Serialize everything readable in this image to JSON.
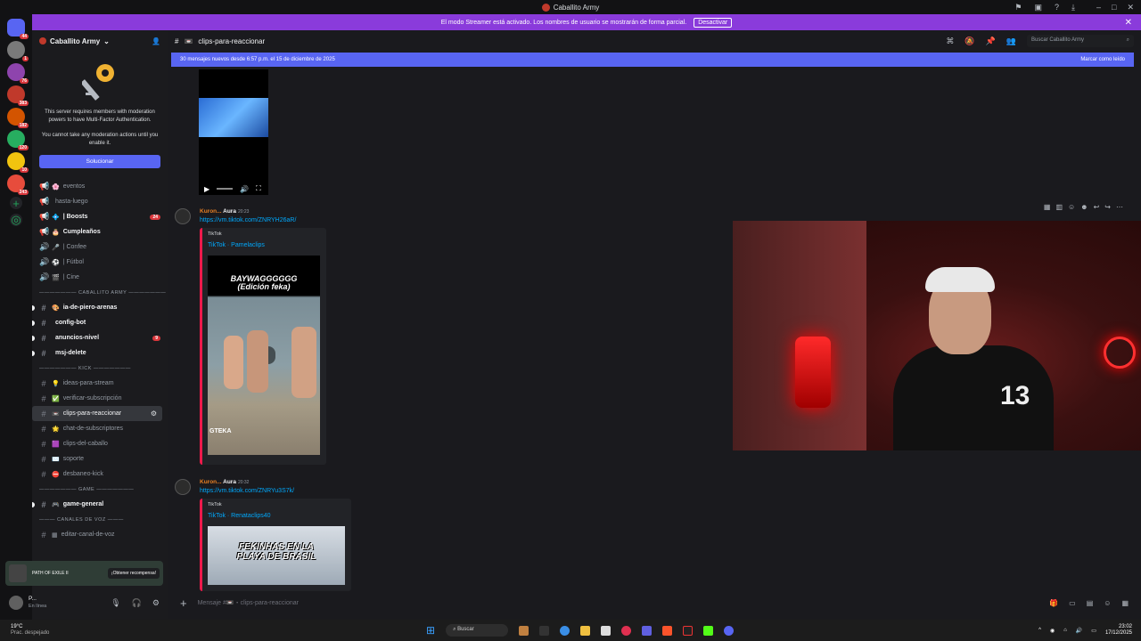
{
  "window": {
    "title": "Caballito Army"
  },
  "banner": {
    "text": "El modo Streamer está activado. Los nombres de usuario se mostrarán de forma parcial.",
    "button": "Desactivar"
  },
  "servers": [
    {
      "badge": "44",
      "color": "#5865f2"
    },
    {
      "badge": "1",
      "color": "#7a7a7a"
    },
    {
      "badge": "76",
      "color": "#8e44ad"
    },
    {
      "badge": "383",
      "color": "#c0392b"
    },
    {
      "badge": "182",
      "color": "#d35400"
    },
    {
      "badge": "120",
      "color": "#27ae60"
    },
    {
      "badge": "10",
      "color": "#f1c40f"
    },
    {
      "badge": "243",
      "color": "#e74c3c"
    }
  ],
  "guild": {
    "name": "Caballito Army"
  },
  "mfa": {
    "line1": "This server requires members with moderation powers to have Multi-Factor Authentication.",
    "line2": "You cannot take any moderation actions until you enable it.",
    "button": "Solucionar"
  },
  "channels": [
    {
      "kind": "ch",
      "hash": "📢",
      "emoji": "🌸",
      "name": "eventos"
    },
    {
      "kind": "ch",
      "hash": "📢",
      "emoji": "",
      "name": "hasta-luego"
    },
    {
      "kind": "ch",
      "hash": "📢",
      "emoji": "💠",
      "name": "| Boosts",
      "bold": true,
      "count": "24"
    },
    {
      "kind": "ch",
      "hash": "📢",
      "emoji": "🎂",
      "name": "Cumpleaños",
      "bold": true
    },
    {
      "kind": "ch",
      "hash": "🔊",
      "emoji": "🎤",
      "name": "| Confee"
    },
    {
      "kind": "ch",
      "hash": "🔊",
      "emoji": "⚽",
      "name": "| Fútbol"
    },
    {
      "kind": "ch",
      "hash": "🔊",
      "emoji": "🎬",
      "name": "| Cine"
    },
    {
      "kind": "cat",
      "name": "——————— CABALLITO ARMY ———————"
    },
    {
      "kind": "ch",
      "hash": "#",
      "emoji": "🎨",
      "name": "ia-de-piero-arenas",
      "bold": true,
      "unread": true
    },
    {
      "kind": "ch",
      "hash": "#",
      "emoji": "",
      "name": "config-bot",
      "bold": true,
      "unread": true
    },
    {
      "kind": "ch",
      "hash": "#",
      "emoji": "",
      "name": "anuncios-nivel",
      "bold": true,
      "unread": true,
      "count": "9"
    },
    {
      "kind": "ch",
      "hash": "#",
      "emoji": "",
      "name": "msj-delete",
      "bold": true,
      "unread": true
    },
    {
      "kind": "cat",
      "name": "——————— KICK ———————"
    },
    {
      "kind": "ch",
      "hash": "#",
      "emoji": "💡",
      "name": "ideas-para-stream"
    },
    {
      "kind": "ch",
      "hash": "#",
      "emoji": "✅",
      "name": "verificar-subscripción"
    },
    {
      "kind": "ch",
      "hash": "#",
      "emoji": "📼",
      "name": "clips-para-reaccionar",
      "selected": true
    },
    {
      "kind": "ch",
      "hash": "#",
      "emoji": "🌟",
      "name": "chat-de-subscriptores"
    },
    {
      "kind": "ch",
      "hash": "#",
      "emoji": "🟪",
      "name": "clips-del-caballo"
    },
    {
      "kind": "ch",
      "hash": "#",
      "emoji": "✉️",
      "name": "soporte"
    },
    {
      "kind": "ch",
      "hash": "#",
      "emoji": "⛔",
      "name": "desbaneo-kick"
    },
    {
      "kind": "cat",
      "name": "——————— GAME ———————"
    },
    {
      "kind": "ch",
      "hash": "#",
      "emoji": "🎮",
      "name": "game-general",
      "bold": true,
      "unread": true
    },
    {
      "kind": "cat",
      "name": "——— CANALES DE VOZ ———"
    },
    {
      "kind": "ch",
      "hash": "#",
      "emoji": "▦",
      "name": "editar-canal-de-voz"
    }
  ],
  "game_panel": {
    "name": "PATH OF EXILE II",
    "button": "¡Obtener recompensa!"
  },
  "user": {
    "name": "P...",
    "status": "En línea"
  },
  "channel_header": {
    "name": "clips-para-reaccionar",
    "search_placeholder": "Buscar Caballito Army"
  },
  "new_messages": {
    "text": "30 mensajes nuevos desde 6:57 p.m. el 15 de diciembre de 2025",
    "mark_read": "Marcar como leído"
  },
  "messages": [
    {
      "author": "Kuron...",
      "tag": "Aura",
      "time": "20:23",
      "link": "https://vm.tiktok.com/ZNRYH26aR/",
      "provider": "TikTok",
      "embed_title": "TikTok · Pamelaclips",
      "caption1": "BAYWAGGGGGG",
      "caption2": "(Edición feka)",
      "watermark": "GTEKA"
    },
    {
      "author": "Kuron...",
      "tag": "Aura",
      "time": "20:32",
      "link": "https://vm.tiktok.com/ZNRYu3S7k/",
      "provider": "TikTok",
      "embed_title": "TikTok · Renataclips40",
      "caption1": "FEKINHAS EN LA",
      "caption2": "PLAYA DE BRASIL"
    }
  ],
  "composer": {
    "placeholder": "Mensaje #📼・clips-para-reaccionar"
  },
  "taskbar": {
    "weather_temp": "19°C",
    "weather_desc": "Prac. despejado",
    "search": "Buscar",
    "time": "23:02",
    "date": "17/12/2025"
  }
}
